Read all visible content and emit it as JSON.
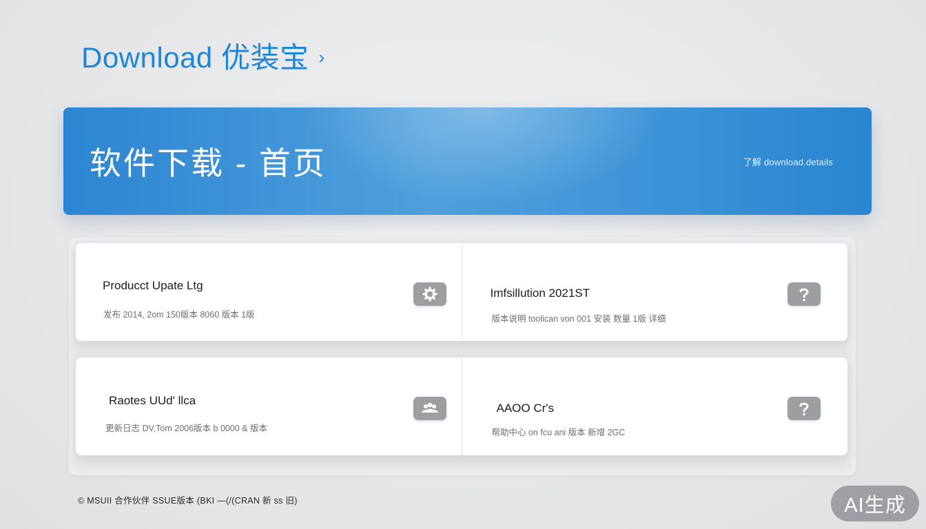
{
  "header": {
    "title": "Download 优装宝",
    "arrow_glyph": "›"
  },
  "banner": {
    "title": "软件下载 - 首页",
    "meta": "了解 download.details"
  },
  "cards": [
    {
      "title": "Producct Upate Ltg",
      "subtitle": "发布 2014, 2om 150版本 8060 版本 1版",
      "icon": "gear-icon"
    },
    {
      "title": "Imfsillution 2021ST",
      "subtitle": "版本说明 toolican von 001 安装 数量 1版 详细",
      "icon": "question-icon"
    },
    {
      "title": "Raotes UUd' llca",
      "subtitle": "更新日志 DV,Tom 2006版本 b 0000 & 版本",
      "icon": "group-icon"
    },
    {
      "title": "AAOO Cr's",
      "subtitle": "帮助中心 on fcu ani 版本 新增 2GC",
      "icon": "question-icon"
    }
  ],
  "footer": {
    "note": "© MSUII 合作伙伴 SSUE版本 (BKI —(/(CRAN 新 ss 旧)"
  },
  "badge": {
    "label": "AI生成"
  },
  "colors": {
    "accent": "#1e86d6",
    "banner_blue": "#3f95d8",
    "button_gray": "#9c9ea1"
  }
}
